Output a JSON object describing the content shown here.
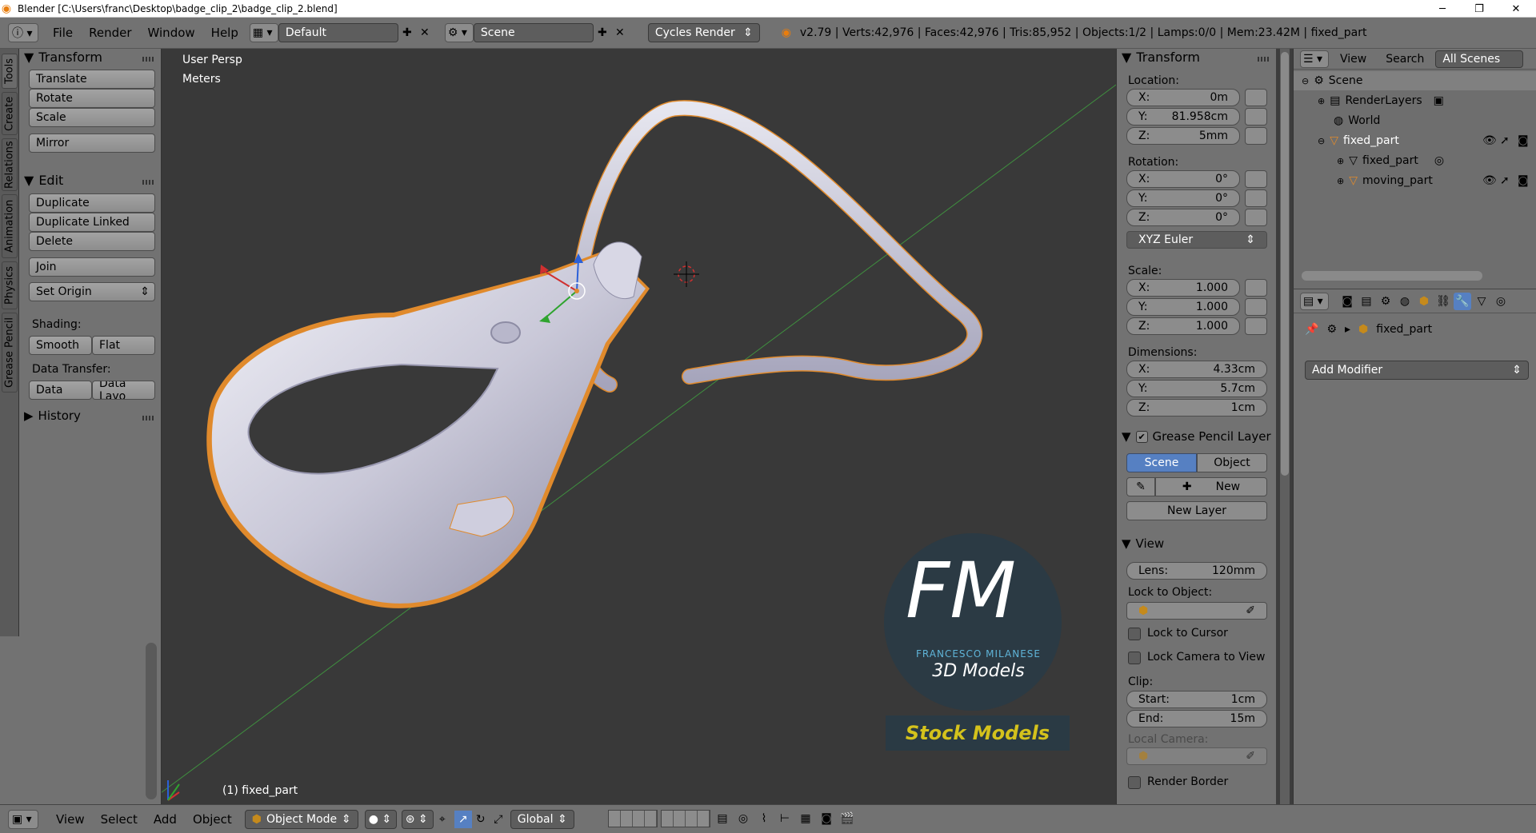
{
  "window": {
    "title": "Blender [C:\\Users\\franc\\Desktop\\badge_clip_2\\badge_clip_2.blend]",
    "controls": [
      "─",
      "❐",
      "✕"
    ]
  },
  "infobar": {
    "menus": [
      "File",
      "Render",
      "Window",
      "Help"
    ],
    "layout": "Default",
    "scene": "Scene",
    "engine": "Cycles Render",
    "stats": "v2.79 | Verts:42,976 | Faces:42,976 | Tris:85,952 | Objects:1/2 | Lamps:0/0 | Mem:23.42M | fixed_part"
  },
  "left_tabs": [
    "Tools",
    "Create",
    "Relations",
    "Animation",
    "Physics",
    "Grease Pencil"
  ],
  "tool_shelf": {
    "transform_header": "Transform",
    "translate": "Translate",
    "rotate": "Rotate",
    "scale": "Scale",
    "mirror": "Mirror",
    "edit_header": "Edit",
    "duplicate": "Duplicate",
    "duplicate_linked": "Duplicate Linked",
    "delete": "Delete",
    "join": "Join",
    "set_origin": "Set Origin",
    "shading_label": "Shading:",
    "smooth": "Smooth",
    "flat": "Flat",
    "data_transfer_label": "Data Transfer:",
    "data": "Data",
    "data_layout": "Data Layo",
    "history_header": "History"
  },
  "viewport": {
    "view_name": "User Persp",
    "units": "Meters",
    "object_label": "(1) fixed_part",
    "watermark": {
      "logo": "FM",
      "brand": "FRANCESCO MILANESE",
      "subtitle": "3D Models",
      "banner": "Stock Models"
    }
  },
  "npanel": {
    "transform_header": "Transform",
    "location_label": "Location:",
    "loc": [
      {
        "k": "X:",
        "v": "0m"
      },
      {
        "k": "Y:",
        "v": "81.958cm"
      },
      {
        "k": "Z:",
        "v": "5mm"
      }
    ],
    "rotation_label": "Rotation:",
    "rot": [
      {
        "k": "X:",
        "v": "0°"
      },
      {
        "k": "Y:",
        "v": "0°"
      },
      {
        "k": "Z:",
        "v": "0°"
      }
    ],
    "rotation_mode": "XYZ Euler",
    "scale_label": "Scale:",
    "scale": [
      {
        "k": "X:",
        "v": "1.000"
      },
      {
        "k": "Y:",
        "v": "1.000"
      },
      {
        "k": "Z:",
        "v": "1.000"
      }
    ],
    "dimensions_label": "Dimensions:",
    "dims": [
      {
        "k": "X:",
        "v": "4.33cm"
      },
      {
        "k": "Y:",
        "v": "5.7cm"
      },
      {
        "k": "Z:",
        "v": "1cm"
      }
    ],
    "grease_header": "Grease Pencil Layer",
    "gp_scene": "Scene",
    "gp_object": "Object",
    "gp_new": "New",
    "gp_new_layer": "New Layer",
    "view_header": "View",
    "lens_label": "Lens:",
    "lens_value": "120mm",
    "lock_to_object": "Lock to Object:",
    "lock_to_cursor": "Lock to Cursor",
    "lock_camera": "Lock Camera to View",
    "clip_label": "Clip:",
    "clip_start_label": "Start:",
    "clip_start": "1cm",
    "clip_end_label": "End:",
    "clip_end": "15m",
    "local_camera": "Local Camera:",
    "render_border": "Render Border"
  },
  "outliner": {
    "view": "View",
    "search": "Search",
    "filter": "All Scenes",
    "rows": [
      {
        "label": "Scene"
      },
      {
        "label": "RenderLayers"
      },
      {
        "label": "World"
      },
      {
        "label": "fixed_part"
      },
      {
        "label": "fixed_part"
      },
      {
        "label": "moving_part"
      }
    ]
  },
  "properties": {
    "object_name": "fixed_part",
    "add_modifier": "Add Modifier"
  },
  "bottombar": {
    "view": "View",
    "select": "Select",
    "add": "Add",
    "object": "Object",
    "mode": "Object Mode",
    "orientation": "Global"
  },
  "colors": {
    "selection_outline": "#e08a2c",
    "active_tab": "#5680c2",
    "viewport_bg": "#393939"
  }
}
